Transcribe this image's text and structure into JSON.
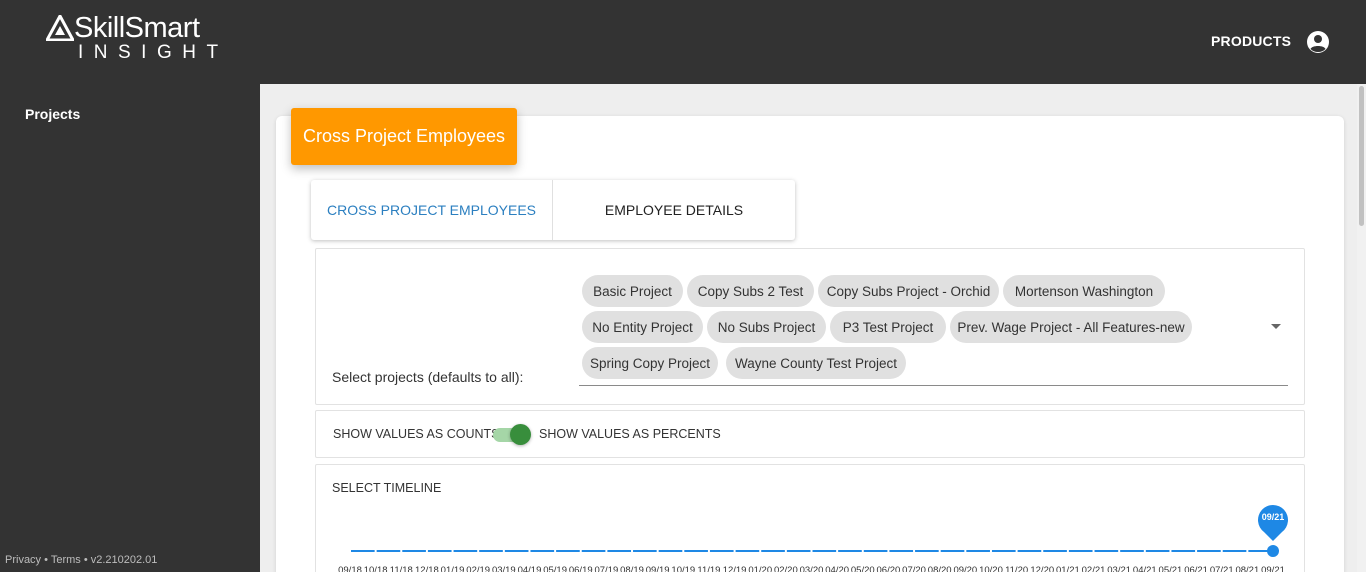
{
  "brand": {
    "name": "SkillSmart",
    "sub": "INSIGHT"
  },
  "header": {
    "products_label": "PRODUCTS",
    "account_icon": "account-circle-icon"
  },
  "sidebar": {
    "items": [
      {
        "label": "Projects"
      }
    ],
    "footer": "Privacy • Terms • v2.210202.01"
  },
  "card": {
    "title": "Cross Project Employees"
  },
  "tabs": [
    {
      "label": "CROSS PROJECT EMPLOYEES",
      "active": true
    },
    {
      "label": "EMPLOYEE DETAILS",
      "active": false
    }
  ],
  "projects": {
    "label": "Select projects (defaults to all):",
    "chips": [
      "Basic Project",
      "Copy Subs 2 Test",
      "Copy Subs Project - Orchid",
      "Mortenson Washington",
      "No Entity Project",
      "No Subs Project",
      "P3 Test Project",
      "Prev. Wage Project - All Features-new",
      "Spring Copy Project",
      "Wayne County Test Project"
    ]
  },
  "toggle": {
    "left_label": "SHOW VALUES AS COUNTS",
    "right_label": "SHOW VALUES AS PERCENTS",
    "checked": true
  },
  "timeline": {
    "label": "SELECT TIMELINE",
    "ticks": [
      "09/18",
      "10/18",
      "11/18",
      "12/18",
      "01/19",
      "02/19",
      "03/19",
      "04/19",
      "05/19",
      "06/19",
      "07/19",
      "08/19",
      "09/19",
      "10/19",
      "11/19",
      "12/19",
      "01/20",
      "02/20",
      "03/20",
      "04/20",
      "05/20",
      "06/20",
      "07/20",
      "08/20",
      "09/20",
      "10/20",
      "11/20",
      "12/20",
      "01/21",
      "02/21",
      "03/21",
      "04/21",
      "05/21",
      "06/21",
      "07/21",
      "08/21",
      "09/21"
    ],
    "selected": "09/21",
    "accent": "#1e88e5"
  }
}
